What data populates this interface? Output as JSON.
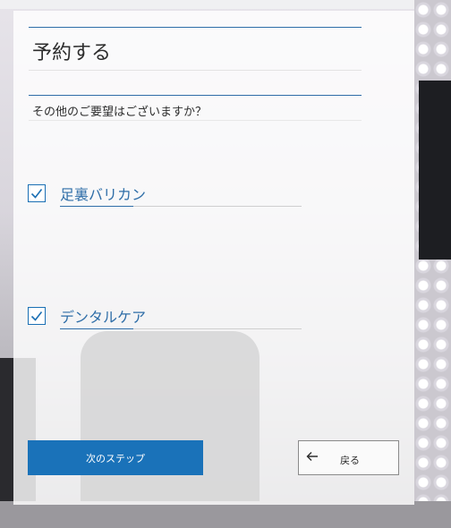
{
  "form": {
    "title": "予約する",
    "question": "その他のご要望はございますか？",
    "options": [
      {
        "label": "足裏バリカン",
        "checked": true
      },
      {
        "label": "デンタルケア",
        "checked": true
      }
    ],
    "next_button": "次のステップ",
    "back_button": "戻る"
  },
  "colors": {
    "accent": "#1a72b9",
    "text": "#2d2d2d",
    "option_text": "#2f6ea8"
  },
  "icons": {
    "check": "checkmark-icon",
    "back": "arrow-left-icon"
  }
}
